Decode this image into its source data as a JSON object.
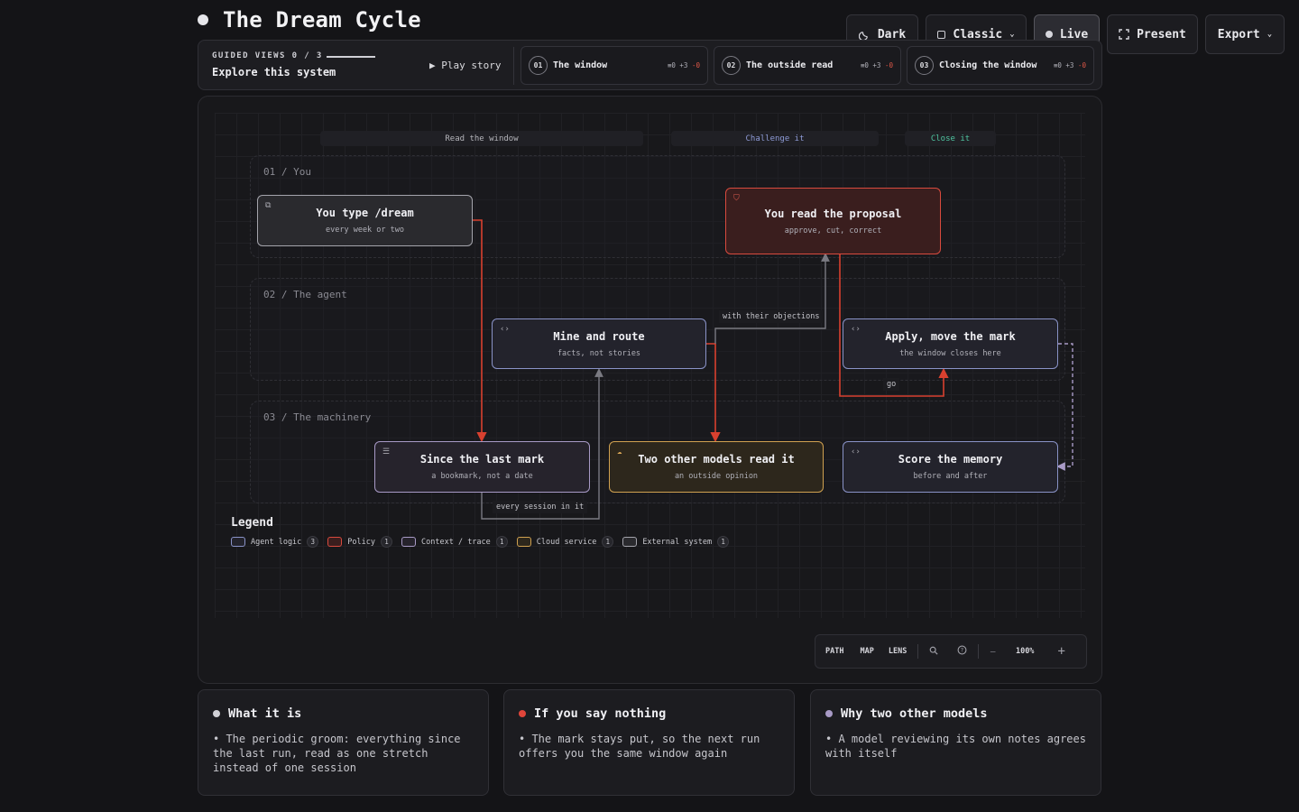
{
  "header": {
    "title": "The Dream Cycle"
  },
  "top_controls": {
    "theme": "Dark",
    "style": "Classic",
    "live": "Live",
    "present": "Present",
    "export": "Export"
  },
  "guided": {
    "kicker": "GUIDED VIEWS 0 / 3",
    "subtitle": "Explore this system",
    "play": "▶ Play story",
    "steps": [
      {
        "num": "01",
        "label": "The window",
        "stats_a": "≡0 +3",
        "stats_b": "-0"
      },
      {
        "num": "02",
        "label": "The outside read",
        "stats_a": "≡0 +3",
        "stats_b": "-0"
      },
      {
        "num": "03",
        "label": "Closing the window",
        "stats_a": "≡0 +3",
        "stats_b": "-0"
      }
    ]
  },
  "diagram": {
    "lanes": [
      "Read the window",
      "Challenge it",
      "Close it"
    ],
    "lane_colors": [
      "#a8a8b0",
      "#8e9ad6",
      "#4fc4a0"
    ],
    "bands": [
      "01 / You",
      "02 / The agent",
      "03 / The machinery"
    ],
    "nodes": {
      "dream": {
        "title": "You type /dream",
        "sub": "every week or two",
        "icon": "terminal-icon"
      },
      "proposal": {
        "title": "You read the proposal",
        "sub": "approve, cut, correct",
        "icon": "shield-icon"
      },
      "mine": {
        "title": "Mine and route",
        "sub": "facts, not stories",
        "icon": "code-icon"
      },
      "apply": {
        "title": "Apply, move the mark",
        "sub": "the window closes here",
        "icon": "code-icon"
      },
      "since": {
        "title": "Since the last mark",
        "sub": "a bookmark, not a date",
        "icon": "database-icon"
      },
      "models": {
        "title": "Two other models read it",
        "sub": "an outside opinion",
        "icon": "cloud-icon"
      },
      "score": {
        "title": "Score the memory",
        "sub": "before and after",
        "icon": "code-icon"
      }
    },
    "edge_labels": {
      "objections": "with their objections",
      "go": "go",
      "every_session": "every session in it"
    },
    "edge_colors": {
      "red": "#d8402f",
      "gray": "#7a7a82",
      "purple": "#a89ac6"
    }
  },
  "legend": {
    "title": "Legend",
    "items": [
      {
        "label": "Agent logic",
        "count": "3",
        "color": "#8a93c8"
      },
      {
        "label": "Policy",
        "count": "1",
        "color": "#d84a3e"
      },
      {
        "label": "Context / trace",
        "count": "1",
        "color": "#a89ac6"
      },
      {
        "label": "Cloud service",
        "count": "1",
        "color": "#d0a150"
      },
      {
        "label": "External system",
        "count": "1",
        "color": "#a4a4ac"
      }
    ]
  },
  "toolbar": {
    "path": "PATH",
    "map": "MAP",
    "lens": "LENS",
    "minus": "−",
    "zoom": "100%",
    "plus": "+"
  },
  "cards": [
    {
      "title": "What it is",
      "dot": "#d0d0d6",
      "body": "• The periodic groom: everything since the last run, read as one stretch instead of one session"
    },
    {
      "title": "If you say nothing",
      "dot": "#e0453a",
      "body": "• The mark stays put, so the next run offers you the same window again"
    },
    {
      "title": "Why two other models",
      "dot": "#a89ac6",
      "body": "• A model reviewing its own notes agrees with itself"
    }
  ]
}
